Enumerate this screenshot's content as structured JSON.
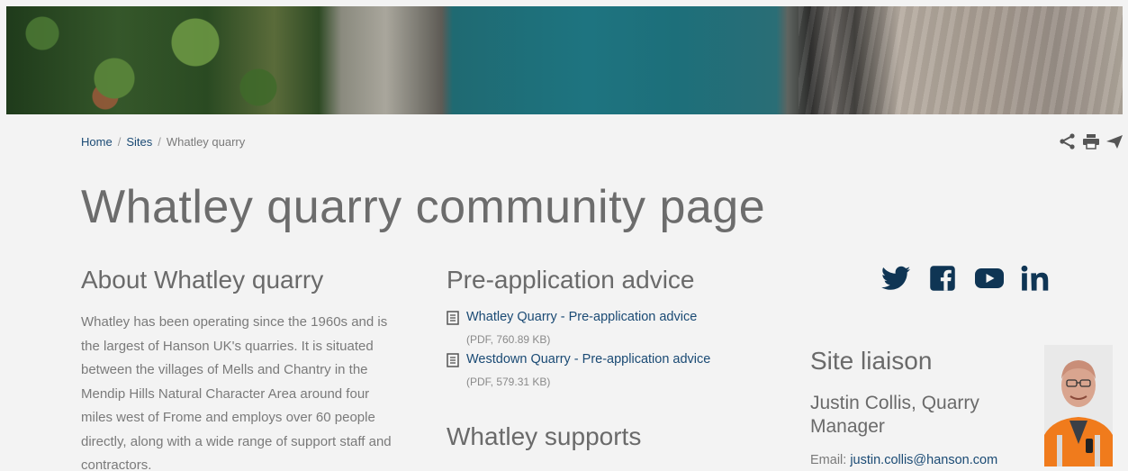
{
  "breadcrumb": {
    "home": "Home",
    "sites": "Sites",
    "current": "Whatley quarry",
    "sep": "/"
  },
  "tools": [
    "share-icon",
    "print-icon",
    "send-icon"
  ],
  "page_title": "Whatley quarry community page",
  "about": {
    "heading": "About Whatley quarry",
    "body": "Whatley has been operating since the 1960s and is the largest of Hanson UK's quarries. It is situated between the villages of Mells and Chantry in the Mendip Hills Natural Character Area around four miles west of Frome and employs over 60 people directly, along with a wide range of support staff and contractors."
  },
  "pre_application": {
    "heading": "Pre-application advice",
    "documents": [
      {
        "title": "Whatley Quarry - Pre-application advice",
        "meta": "(PDF, 760.89 KB)"
      },
      {
        "title": "Westdown Quarry - Pre-application advice",
        "meta": "(PDF, 579.31 KB)"
      }
    ],
    "next_heading": "Whatley supports"
  },
  "social": [
    "twitter-icon",
    "facebook-icon",
    "youtube-icon",
    "linkedin-icon"
  ],
  "liaison": {
    "heading": "Site liaison",
    "name": "Justin Collis, Quarry Manager",
    "email_label": "Email: ",
    "email": "justin.collis@hanson.com"
  },
  "colors": {
    "link": "#1a4a74",
    "social": "#0f3554",
    "background": "#f3f3f3",
    "text": "#6c6c6c"
  }
}
